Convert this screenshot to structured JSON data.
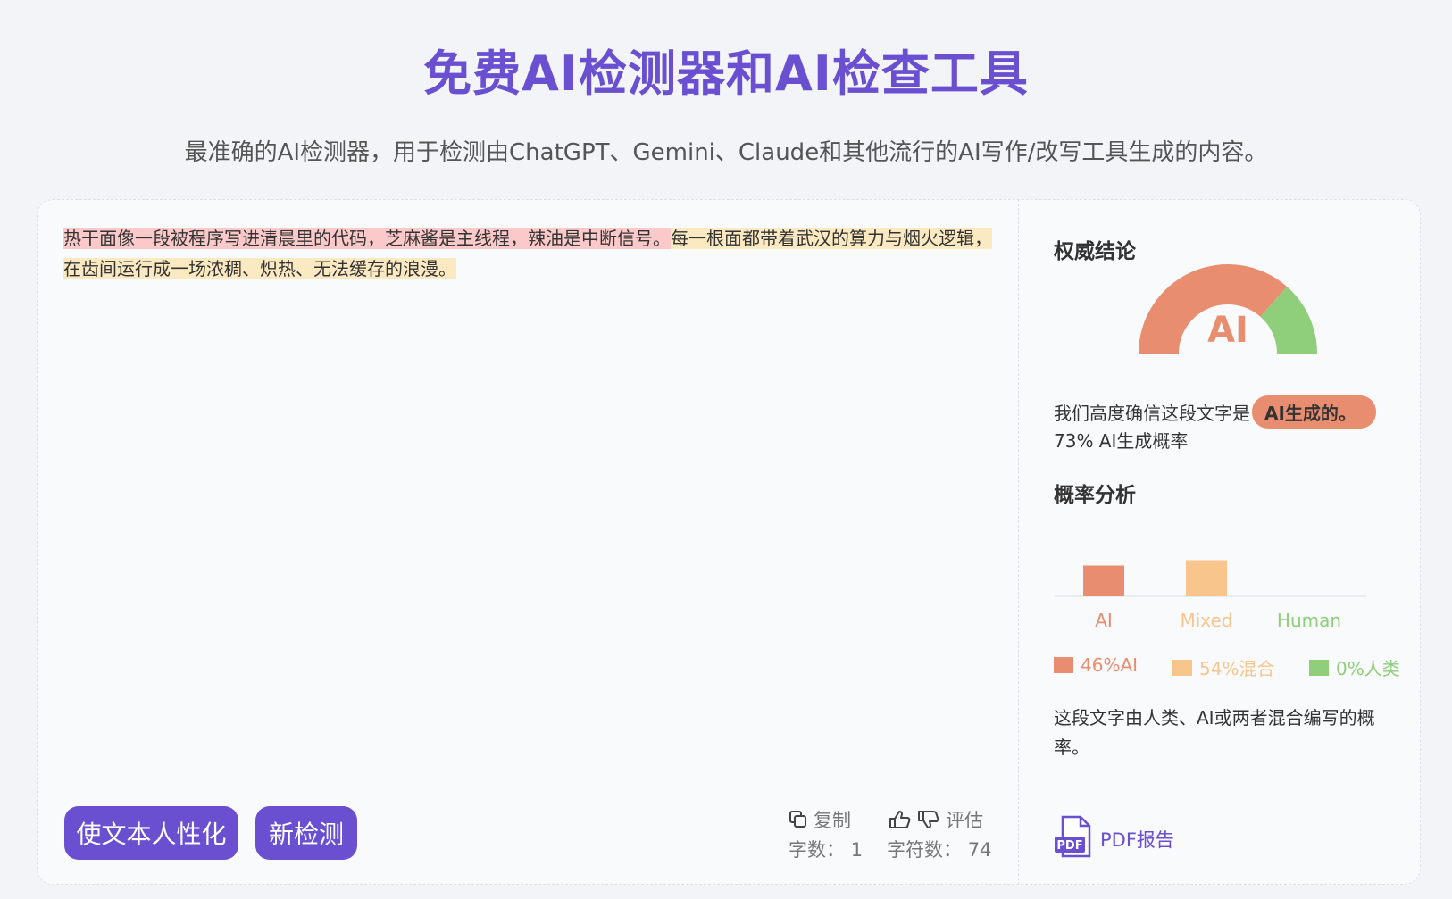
{
  "header": {
    "title": "免费AI检测器和AI检查工具",
    "subtitle": "最准确的AI检测器，用于检测由ChatGPT、Gemini、Claude和其他流行的AI写作/改写工具生成的内容。"
  },
  "input": {
    "segment_ai": "热干面像一段被程序写进清晨里的代码，芝麻酱是主线程，辣油是中断信号。",
    "segment_mixed": "每一根面都带着武汉的算力与烟火逻辑，在齿间运行成一场浓稠、炽热、无法缓存的浪漫。"
  },
  "actions": {
    "humanize_label": "使文本人性化",
    "new_check_label": "新检测",
    "copy_label": "复制",
    "rate_label": "评估",
    "word_count_label": "字数：",
    "word_count_value": "1",
    "char_count_label": "字符数：",
    "char_count_value": "74"
  },
  "result": {
    "verdict_title": "权威结论",
    "gauge_label": "AI",
    "gauge_ai_fraction": 0.73,
    "confidence_prefix": "我们高度确信这段文字是",
    "confidence_badge": "AI生成的。",
    "probability_text": "73% AI生成概率",
    "analysis_title": "概率分析",
    "legend": {
      "ai": "46%AI",
      "mixed": "54%混合",
      "human": "0%人类"
    },
    "description": "这段文字由人类、AI或两者混合编写的概率。",
    "pdf_label": "PDF报告",
    "pdf_icon_text": "PDF"
  },
  "colors": {
    "accent": "#6a4fd1",
    "ai": "#e98d70",
    "mixed": "#f8c58c",
    "human": "#8fce7a"
  },
  "chart_data": {
    "type": "bar",
    "categories": [
      "AI",
      "Mixed",
      "Human"
    ],
    "values": [
      46,
      54,
      0
    ],
    "colors": [
      "#e98d70",
      "#f8c58c",
      "#8fce7a"
    ],
    "ylim": [
      0,
      100
    ],
    "grid": false
  }
}
